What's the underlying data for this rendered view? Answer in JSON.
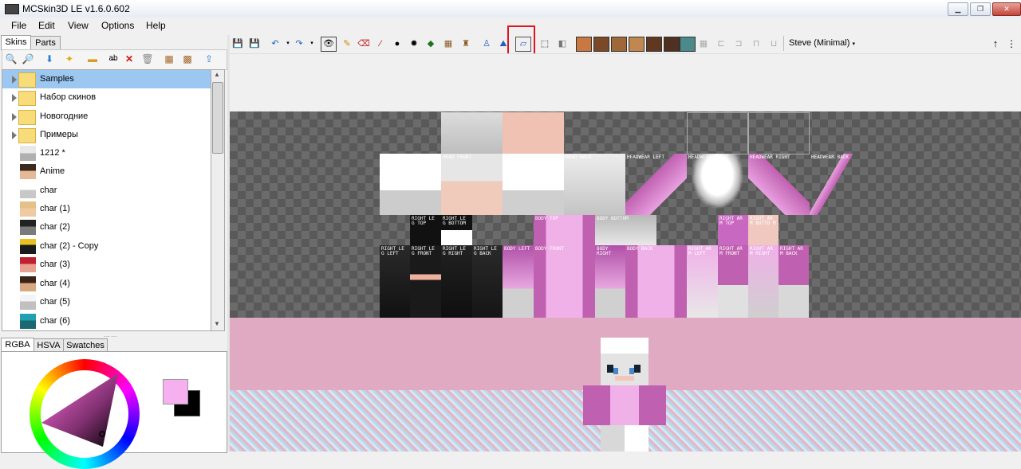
{
  "window": {
    "title": "MCSkin3D LE v1.6.0.602",
    "minimize": "▁",
    "maximize": "❐",
    "close": "✕"
  },
  "menu": [
    "File",
    "Edit",
    "View",
    "Options",
    "Help"
  ],
  "left_tabs": [
    "Skins",
    "Parts"
  ],
  "skins": [
    {
      "label": "Samples",
      "type": "folder",
      "selected": true
    },
    {
      "label": "Набор скинов",
      "type": "folder"
    },
    {
      "label": "Новогодние",
      "type": "folder"
    },
    {
      "label": "Примеры",
      "type": "folder"
    },
    {
      "label": "1212 *",
      "type": "skin"
    },
    {
      "label": "Anime",
      "type": "skin"
    },
    {
      "label": "char",
      "type": "skin"
    },
    {
      "label": "char (1)",
      "type": "skin"
    },
    {
      "label": "char (2)",
      "type": "skin"
    },
    {
      "label": "char (2) - Copy",
      "type": "skin"
    },
    {
      "label": "char (3)",
      "type": "skin"
    },
    {
      "label": "char (4)",
      "type": "skin"
    },
    {
      "label": "char (5)",
      "type": "skin"
    },
    {
      "label": "char (6)",
      "type": "skin"
    }
  ],
  "color_tabs": [
    "RGBA",
    "HSVA",
    "Swatches"
  ],
  "colors": {
    "primary": "#f6b0f0",
    "secondary": "#000000",
    "accent_highlight": "#e0141c"
  },
  "model_selector": "Steve (Minimal)",
  "parts_labels": {
    "head_left": "HEAD LEFT",
    "head_front": "HEAD FRONT",
    "head_right": "HEAD RIGHT",
    "head_back": "HEAD BACK",
    "headwear_left": "HEADWEAR LEFT",
    "headwear_front": "HEADWEAR FRONT",
    "headwear_right": "HEADWEAR RIGHT",
    "headwear_back": "HEADWEAR BACK",
    "right_leg_top": "RIGHT LE G TOP",
    "right_leg_bottom": "RIGHT LE G BOTTOM",
    "body_top": "BODY TOP",
    "body_bottom": "BODY BOTTOM",
    "right_arm_top": "RIGHT AR M TOP",
    "right_arm_bottom": "RIGHT AR M BOTTO M",
    "right_leg_left": "RIGHT LE G LEFT",
    "right_leg_front": "RIGHT LE G FRONT",
    "right_leg_right": "RIGHT LE G RIGHT",
    "right_leg_back": "RIGHT LE G BACK",
    "body_left": "BODY LEFT",
    "body_front": "BODY FRONT",
    "body_right": "BODY RIGHT",
    "body_back": "BODY BACK",
    "right_arm_left": "RIGHT AR M LEFT",
    "right_arm_front": "RIGHT AR M FRONT",
    "right_arm_right": "RIGHT AR M RIGHT",
    "right_arm_back": "RIGHT AR M BACK"
  }
}
